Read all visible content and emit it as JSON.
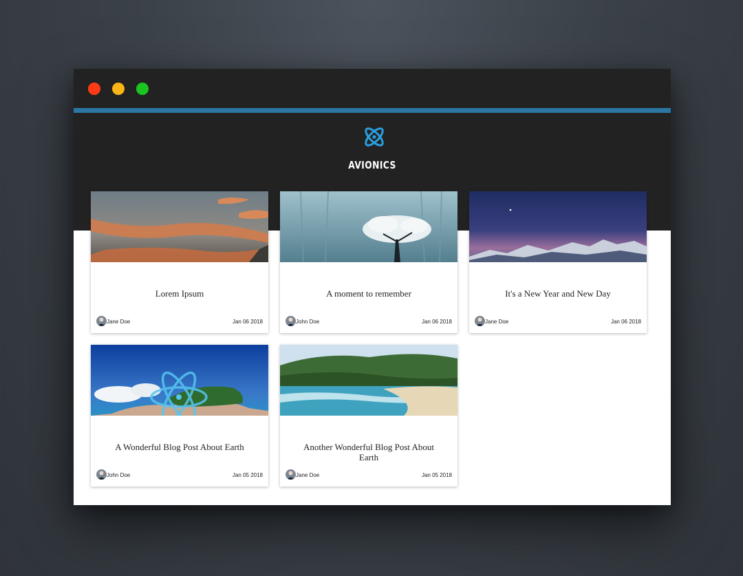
{
  "site": {
    "title": "AVIONICS",
    "logo_icon": "atom-logo-icon",
    "accent_color": "#2b76a3",
    "header_color": "#222222"
  },
  "window_controls": {
    "close_color": "#ff3b16",
    "minimize_color": "#f9b415",
    "maximize_color": "#1bc41e"
  },
  "posts": [
    {
      "title": "Lorem Ipsum",
      "author": "Jane Doe",
      "date": "Jan 06 2018",
      "image": "sunset-clouds"
    },
    {
      "title": "A moment to remember",
      "author": "John Doe",
      "date": "Jan 06 2018",
      "image": "foggy-tree"
    },
    {
      "title": "It's a New Year and New Day",
      "author": "Jane Doe",
      "date": "Jan 06 2018",
      "image": "mountain-twilight"
    },
    {
      "title": "A Wonderful Blog Post About Earth",
      "author": "John Doe",
      "date": "Jan 05 2018",
      "image": "tropical-island"
    },
    {
      "title": "Another Wonderful Blog Post About Earth",
      "author": "Jane Doe",
      "date": "Jan 05 2018",
      "image": "beach-hills"
    }
  ]
}
